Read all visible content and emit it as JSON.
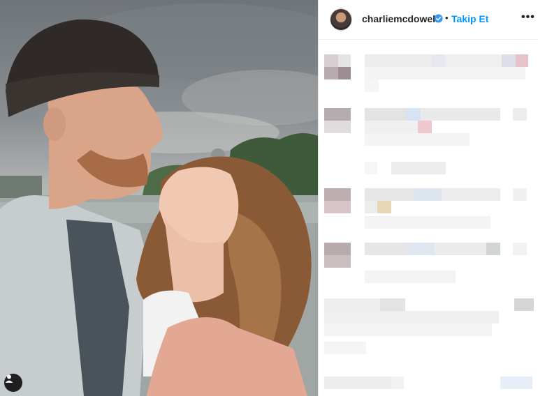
{
  "post": {
    "username": "charliemcdowell",
    "separator": "•",
    "follow_label": "Takip Et",
    "more_label": "•••",
    "verified": true
  },
  "colors": {
    "follow_blue": "#0095f6",
    "verified_blue": "#3897f0",
    "username_text": "#262626"
  },
  "icons": {
    "verified": "verified-badge-icon",
    "more": "more-options-icon",
    "user_tag": "user-tag-icon"
  }
}
